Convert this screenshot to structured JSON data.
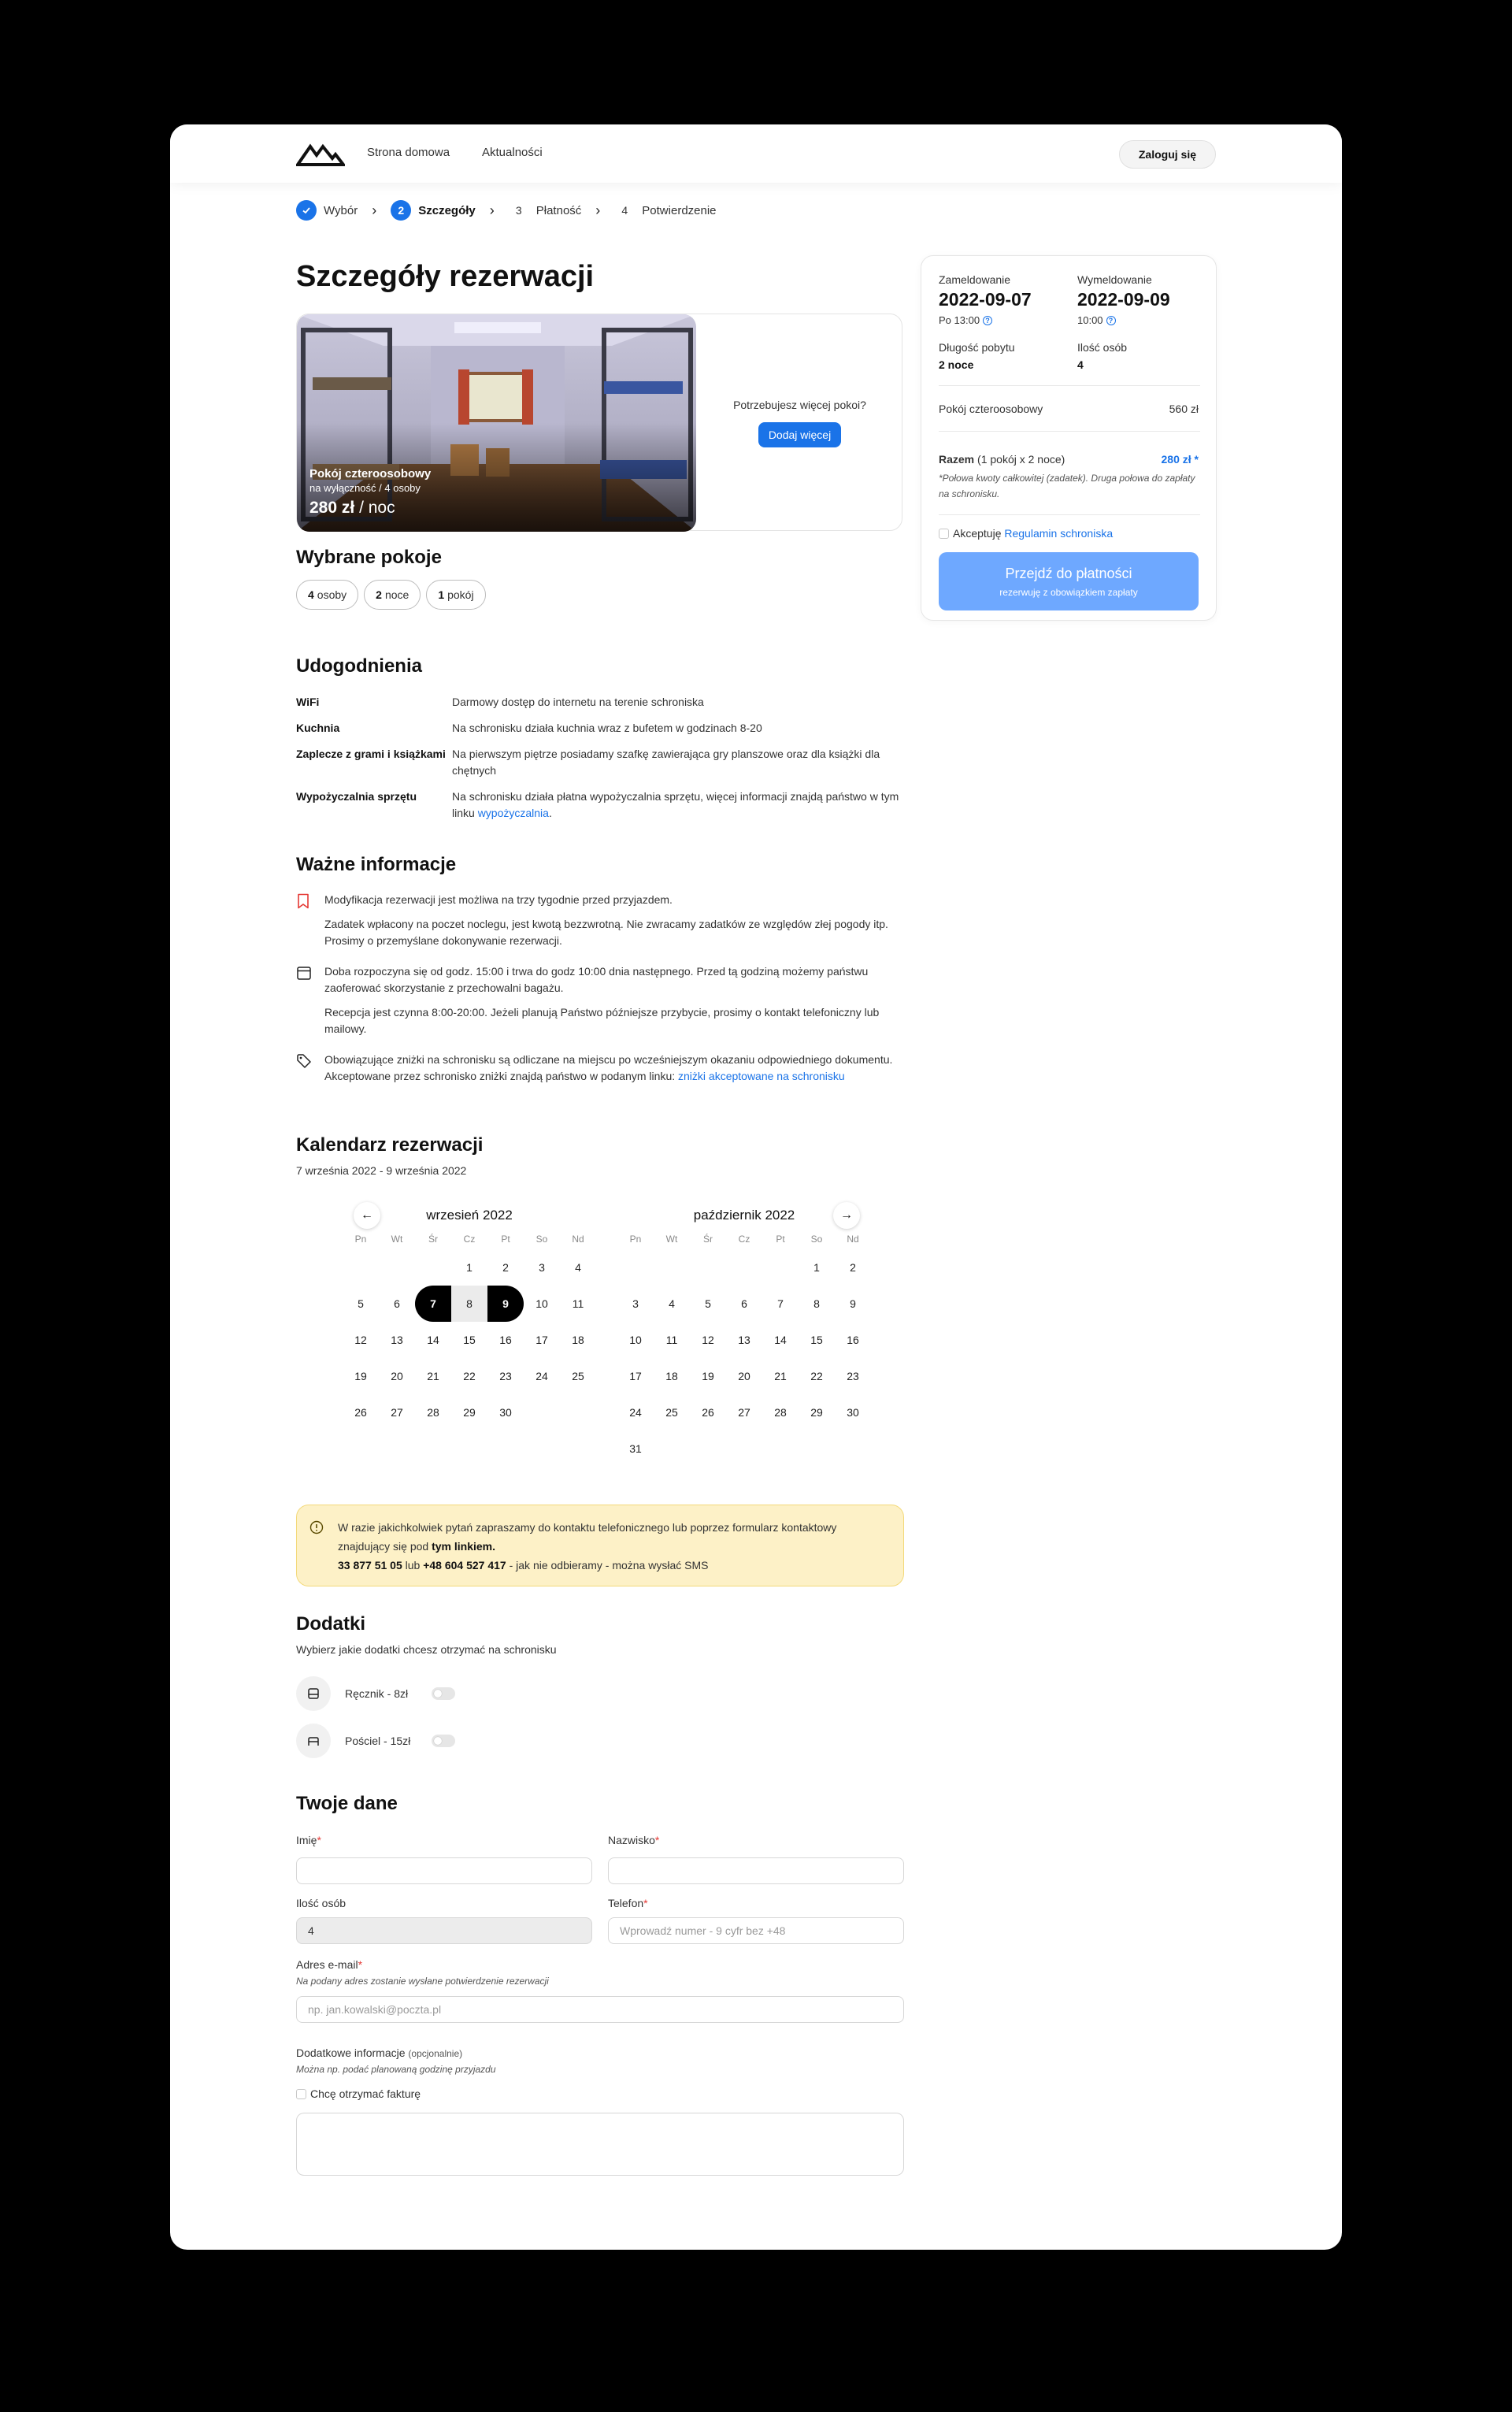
{
  "header": {
    "nav": [
      "Strona domowa",
      "Aktualności"
    ],
    "login": "Zaloguj się"
  },
  "steps": [
    {
      "num": "✓",
      "label": "Wybór",
      "state": "done"
    },
    {
      "num": "2",
      "label": "Szczegóły",
      "state": "active"
    },
    {
      "num": "3",
      "label": "Płatność",
      "state": "pending"
    },
    {
      "num": "4",
      "label": "Potwierdzenie",
      "state": "pending"
    }
  ],
  "page_title": "Szczegóły rezerwacji",
  "room": {
    "name": "Pokój czteroosobowy",
    "subtitle": "na wyłączność / 4 osoby",
    "price": "280 zł",
    "per": "/ noc"
  },
  "more_rooms": {
    "question": "Potrzebujesz więcej pokoi?",
    "button": "Dodaj więcej"
  },
  "selected_rooms": {
    "title": "Wybrane pokoje",
    "pills": [
      {
        "num": "4",
        "label": "osoby"
      },
      {
        "num": "2",
        "label": "noce"
      },
      {
        "num": "1",
        "label": "pokój"
      }
    ]
  },
  "amenities": {
    "title": "Udogodnienia",
    "rows": [
      {
        "k": "WiFi",
        "v": "Darmowy dostęp do internetu na terenie schroniska"
      },
      {
        "k": "Kuchnia",
        "v": "Na schronisku działa kuchnia wraz z bufetem w godzinach 8-20"
      },
      {
        "k": "Zaplecze z grami i książkami",
        "v": "Na pierwszym piętrze posiadamy szafkę zawierająca gry planszowe oraz dla książki dla chętnych"
      },
      {
        "k": "Wypożyczalnia sprzętu",
        "v": "Na schronisku działa płatna wypożyczalnia sprzętu, więcej informacji znajdą państwo w tym linku ",
        "link": "wypożyczalnia",
        "after": "."
      }
    ]
  },
  "important": {
    "title": "Ważne informacje",
    "groups": [
      {
        "icon": "bookmark-icon",
        "lines": [
          "Modyfikacja rezerwacji jest możliwa na trzy tygodnie przed przyjazdem.",
          "Zadatek wpłacony na poczet noclegu, jest kwotą bezzwrotną. Nie zwracamy zadatków ze względów złej pogody itp. Prosimy o przemyślane dokonywanie rezerwacji."
        ]
      },
      {
        "icon": "calendar-icon",
        "lines": [
          "Doba rozpoczyna się od godz. 15:00 i trwa do godz 10:00 dnia następnego. Przed tą godziną możemy państwu zaoferować skorzystanie z przechowalni bagażu.",
          "Recepcja jest czynna 8:00-20:00. Jeżeli planują Państwo późniejsze przybycie, prosimy o kontakt telefoniczny lub mailowy."
        ]
      },
      {
        "icon": "tag-icon",
        "lines": [
          "Obowiązujące zniżki na schronisku są odliczane na miejscu po wcześniejszym okazaniu odpowiedniego dokumentu. Akceptowane przez schronisko zniżki znajdą państwo w podanym linku: "
        ],
        "link": "zniżki akceptowane na schronisku"
      }
    ]
  },
  "calendar": {
    "title": "Kalendarz rezerwacji",
    "range": "7 września 2022 - 9 września 2022",
    "dow": [
      "Pn",
      "Wt",
      "Śr",
      "Cz",
      "Pt",
      "So",
      "Nd"
    ],
    "months": [
      {
        "name": "wrzesień 2022",
        "offset": 3,
        "days": 30,
        "sel_start": 7,
        "sel_end": 9
      },
      {
        "name": "październik 2022",
        "offset": 5,
        "days": 31,
        "sel_start": 0,
        "sel_end": 0
      }
    ]
  },
  "alert": {
    "text": "W razie jakichkolwiek pytań zapraszamy do kontaktu telefonicznego lub poprzez formularz kontaktowy znajdujący się pod ",
    "link": "tym linkiem.",
    "phone1": "33 877 51 05",
    "or": " lub ",
    "phone2": "+48 604 527 417",
    "note": " - jak nie odbieramy - można wysłać SMS"
  },
  "addons": {
    "title": "Dodatki",
    "subtitle": "Wybierz jakie dodatki chcesz otrzymać na schronisku",
    "items": [
      {
        "label": "Ręcznik - 8zł",
        "icon": "towel-icon",
        "on": false
      },
      {
        "label": "Pościel - 15zł",
        "icon": "bed-icon",
        "on": false
      }
    ]
  },
  "form": {
    "title": "Twoje dane",
    "first_name": {
      "label": "Imię",
      "value": ""
    },
    "last_name": {
      "label": "Nazwisko",
      "value": ""
    },
    "guests": {
      "label": "Ilość osób",
      "value": "4"
    },
    "phone": {
      "label": "Telefon",
      "placeholder": "Wprowadź numer - 9 cyfr bez +48"
    },
    "email": {
      "label": "Adres e-mail",
      "hint": "Na podany adres zostanie wysłane potwierdzenie rezerwacji",
      "placeholder": "np. jan.kowalski@poczta.pl"
    },
    "extra": {
      "label": "Dodatkowe informacje",
      "optional": "(opcjonalnie)",
      "hint": "Można np. podać planowaną godzinę przyjazdu"
    },
    "invoice": "Chcę otrzymać fakturę"
  },
  "summary": {
    "checkin_label": "Zameldowanie",
    "checkin_date": "2022-09-07",
    "checkin_time": "Po 13:00",
    "checkout_label": "Wymeldowanie",
    "checkout_date": "2022-09-09",
    "checkout_time": "10:00",
    "stay_label": "Długość pobytu",
    "stay_value": "2 noce",
    "guests_label": "Ilość osób",
    "guests_value": "4",
    "room_label": "Pokój czteroosobowy",
    "room_price": "560 zł",
    "total_label": "Razem",
    "total_detail": "(1 pokój x 2 noce)",
    "total_value": "280 zł *",
    "total_note": "*Połowa kwoty całkowitej (zadatek). Druga połowa do zapłaty na schronisku.",
    "accept_prefix": "Akceptuję",
    "accept_link": "Regulamin schroniska",
    "pay_button": "Przejdź do płatności",
    "pay_sub": "rezerwuję z obowiązkiem zapłaty"
  },
  "colors": {
    "accent": "#1a73e8",
    "pay_button": "#6ea8ff",
    "alert_bg": "#fdf1c7"
  }
}
